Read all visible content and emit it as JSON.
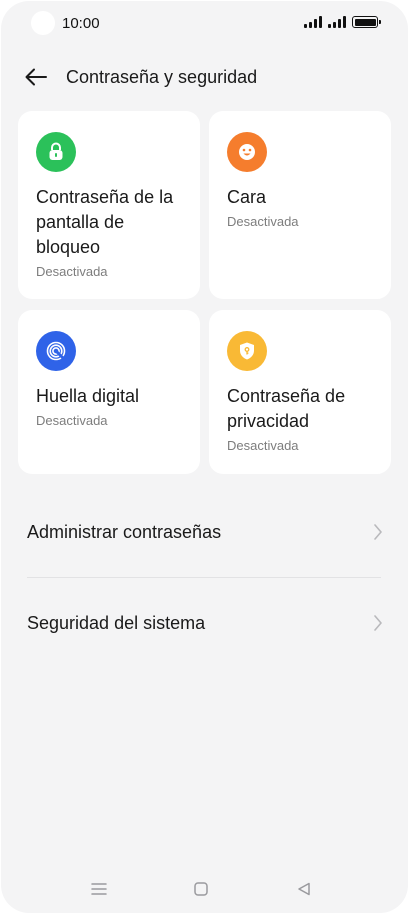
{
  "status_bar": {
    "time": "10:00",
    "battery_level": 1.0
  },
  "header": {
    "title": "Contraseña y seguridad",
    "back_icon": "arrow-left-icon"
  },
  "cards": [
    {
      "title": "Contraseña de la pantalla de bloqueo",
      "status": "Desactivada",
      "icon": "lock-icon",
      "color": "#2bc15a"
    },
    {
      "title": "Cara",
      "status": "Desactivada",
      "icon": "face-icon",
      "color": "#f57d2d"
    },
    {
      "title": "Huella digital",
      "status": "Desactivada",
      "icon": "fingerprint-icon",
      "color": "#2f63e8"
    },
    {
      "title": "Contraseña de privacidad",
      "status": "Desactivada",
      "icon": "shield-key-icon",
      "color": "#f9b935"
    }
  ],
  "list": [
    {
      "label": "Administrar contraseñas"
    },
    {
      "label": "Seguridad del sistema"
    }
  ],
  "nav_bar": {
    "menu_icon": "menu-icon",
    "home_icon": "home-icon",
    "back_icon": "back-triangle-icon"
  }
}
